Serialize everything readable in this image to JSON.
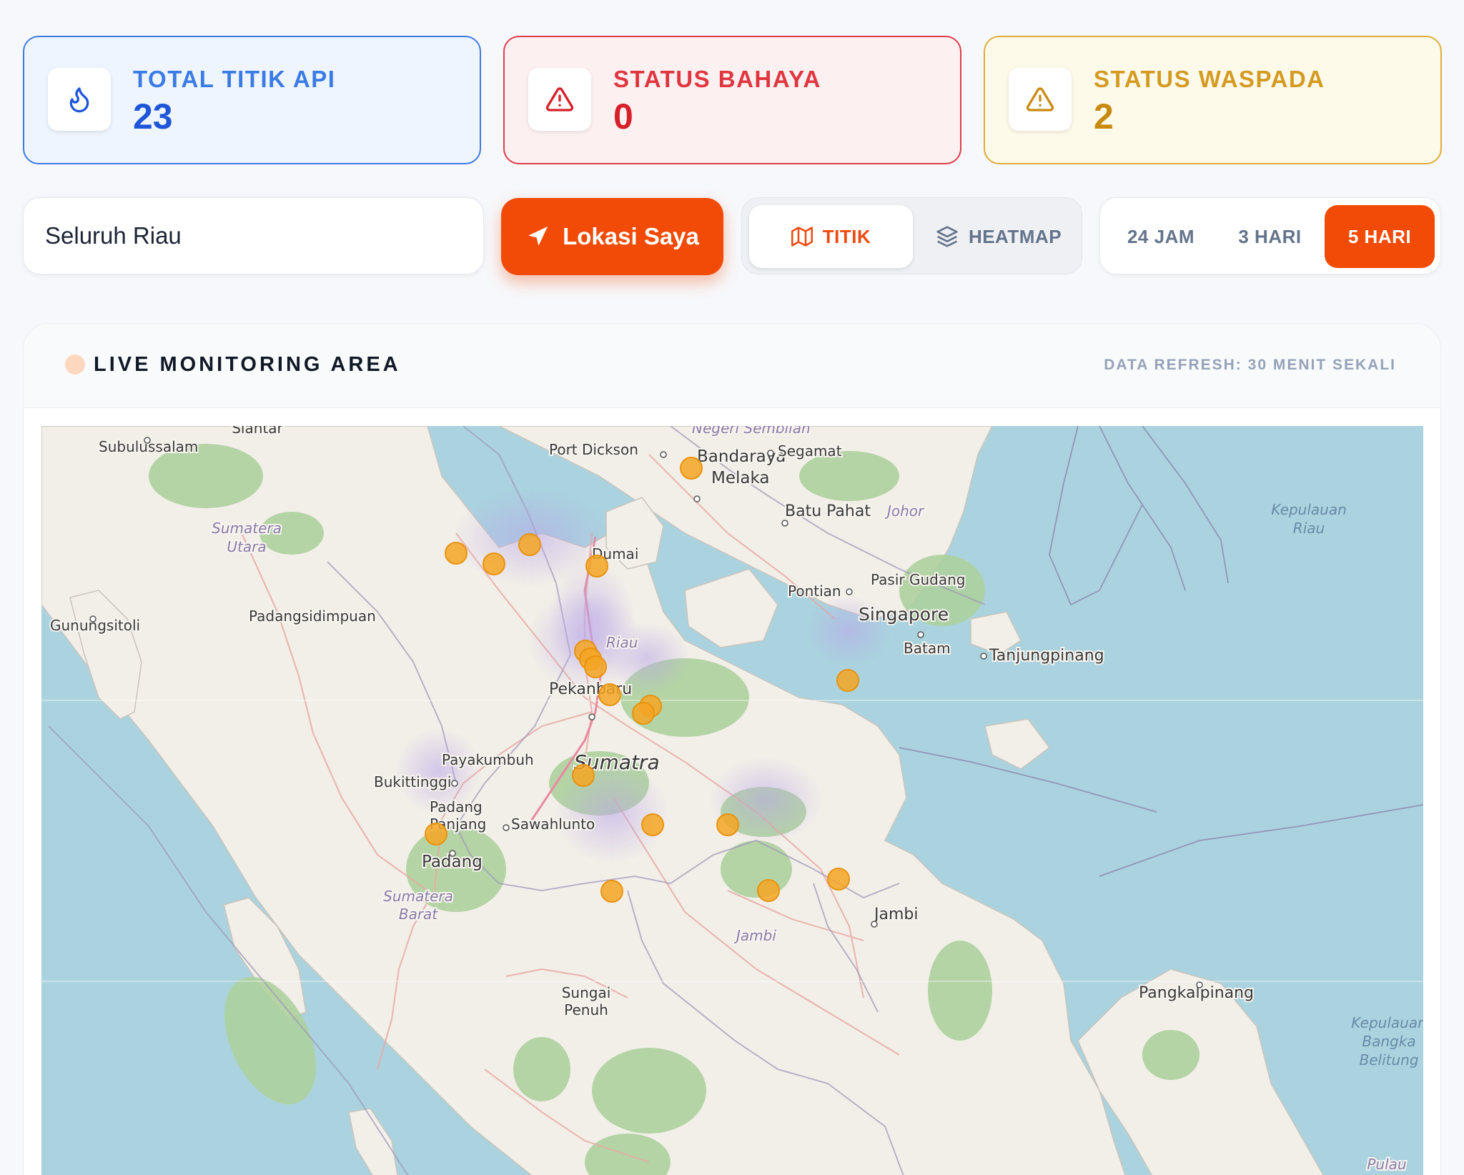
{
  "stats": {
    "total": {
      "label": "TOTAL TITIK API",
      "value": "23",
      "icon": "flame-icon"
    },
    "bahaya": {
      "label": "STATUS BAHAYA",
      "value": "0",
      "icon": "alert-triangle-icon"
    },
    "waspada": {
      "label": "STATUS WASPADA",
      "value": "2",
      "icon": "alert-triangle-icon"
    }
  },
  "filters": {
    "region": "Seluruh Riau",
    "location_button": "Lokasi Saya",
    "view": {
      "titik": "TITIK",
      "heatmap": "HEATMAP",
      "selected": "TITIK"
    },
    "range": {
      "h24": "24 JAM",
      "d3": "3 HARI",
      "d5": "5 HARI",
      "selected": "5 HARI"
    }
  },
  "monitor": {
    "title": "LIVE MONITORING AREA",
    "refresh": "DATA REFRESH: 30 MENIT SEKALI"
  },
  "colors": {
    "accent": "#f24a07",
    "hotspot": "#f5a623",
    "blue": "#1f56d8",
    "red": "#d7202a",
    "amber": "#c98a10"
  },
  "map": {
    "labels": {
      "siantar": "Siantar",
      "subulussalam": "Subulussalam",
      "port_dickson": "Port Dickson",
      "negeri_sembilan": "Negeri Sembilan",
      "bandaraya_melaka_1": "Bandaraya",
      "bandaraya_melaka_2": "Melaka",
      "segamat": "Segamat",
      "batu_pahat": "Batu Pahat",
      "johor": "Johor",
      "kepulauan_riau_1": "Kepulauan",
      "kepulauan_riau_2": "Riau",
      "sumatera_utara_1": "Sumatera",
      "sumatera_utara_2": "Utara",
      "dumai": "Dumai",
      "pontian": "Pontian",
      "pasir_gudang": "Pasir Gudang",
      "singapore": "Singapore",
      "padangsidimpuan": "Padangsidimpuan",
      "gunungsitoli": "Gunungsitoli",
      "riau": "Riau",
      "batam": "Batam",
      "tanjungpinang": "Tanjungpinang",
      "pekanbaru": "Pekanbaru",
      "payakumbuh": "Payakumbuh",
      "sumatra": "Sumatra",
      "bukittinggi": "Bukittinggi",
      "padang_panjang_1": "Padang",
      "padang_panjang_2": "Panjang",
      "sawahlunto": "Sawahlunto",
      "padang": "Padang",
      "sumatera_barat_1": "Sumatera",
      "sumatera_barat_2": "Barat",
      "jambi_city": "Jambi",
      "jambi_prov": "Jambi",
      "sungai_penuh_1": "Sungai",
      "sungai_penuh_2": "Penuh",
      "pangkalpinang": "Pangkalpinang",
      "bangka_1": "Kepulauan",
      "bangka_2": "Bangka",
      "bangka_3": "Belitung",
      "pulau": "Pulau"
    }
  }
}
